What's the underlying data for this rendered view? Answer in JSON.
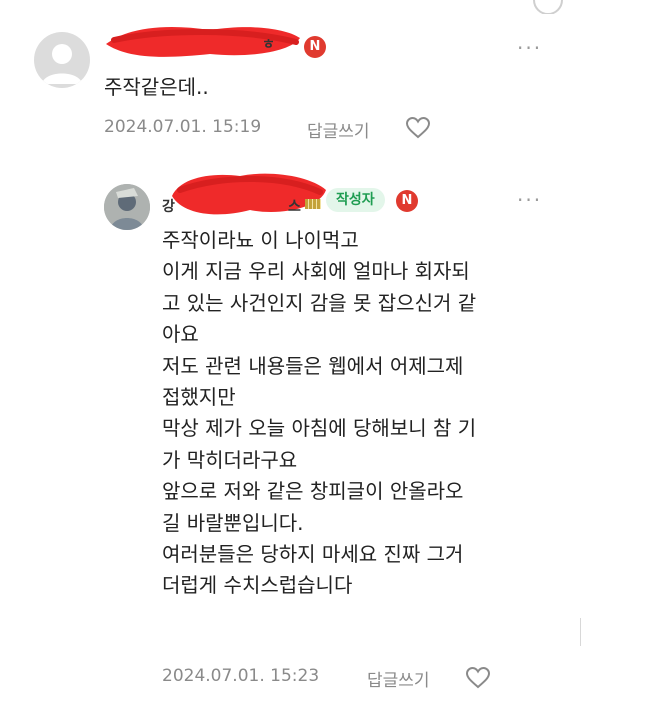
{
  "comments": [
    {
      "badge": "N",
      "name_fragment": "ㅎ",
      "text_lines": [
        "주작같은데.."
      ],
      "timestamp": "2024.07.01. 15:19",
      "reply_label": "답글쓰기",
      "more_label": "···"
    },
    {
      "badge": "N",
      "name_fragment_start": "강",
      "name_fragment_end": "스",
      "author_chip": "작성자",
      "text_lines": [
        "주작이라뇨 이 나이먹고",
        "이게 지금 우리 사회에 얼마나 회자되",
        "고 있는 사건인지 감을 못 잡으신거 같",
        "아요",
        "저도 관련 내용들은 웹에서 어제그제",
        "접했지만",
        "막상 제가 오늘 아침에 당해보니 참 기",
        "가 막히더라구요",
        "앞으로 저와 같은 창피글이 안올라오",
        "길 바랄뿐입니다.",
        "여러분들은 당하지 마세요 진짜 그거",
        "더럽게 수치스럽습니다"
      ],
      "timestamp": "2024.07.01. 15:23",
      "reply_label": "답글쓰기",
      "more_label": "···"
    }
  ],
  "colors": {
    "badge_red": "#e03a2f",
    "author_chip_bg": "#e3f6ea",
    "author_chip_text": "#1f9d52",
    "redaction": "#ef2a2a",
    "meta_gray": "#8a8a8a"
  },
  "icons": [
    "default-avatar-icon",
    "profile-photo-icon",
    "new-badge-icon",
    "more-options-icon",
    "heart-icon"
  ]
}
